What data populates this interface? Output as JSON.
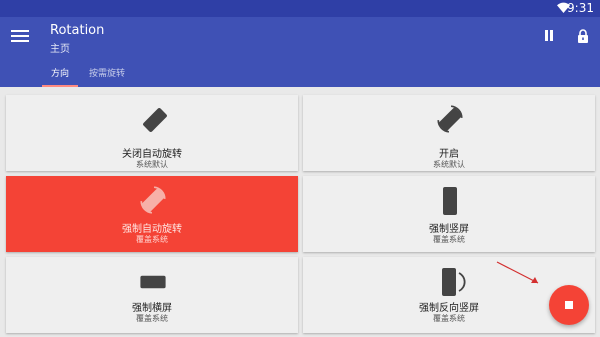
{
  "status": {
    "time": "9:31",
    "wifi_icon": "wifi-icon"
  },
  "appbar": {
    "title": "Rotation",
    "subtitle": "主页",
    "menu_icon": "menu-icon",
    "pause_icon": "pause-icon",
    "lock_icon": "lock-icon"
  },
  "tabs": [
    {
      "label": "方向",
      "active": true
    },
    {
      "label": "按需旋转",
      "active": false
    }
  ],
  "cards": [
    {
      "label": "关闭自动旋转",
      "sub": "系统默认",
      "icon": "rotation-off-icon",
      "active": false
    },
    {
      "label": "开启",
      "sub": "系统默认",
      "icon": "auto-rotate-icon",
      "active": false
    },
    {
      "label": "强制自动旋转",
      "sub": "覆盖系统",
      "icon": "forced-auto-rotate-icon",
      "active": true
    },
    {
      "label": "强制竖屏",
      "sub": "覆盖系统",
      "icon": "portrait-icon",
      "active": false
    },
    {
      "label": "强制横屏",
      "sub": "覆盖系统",
      "icon": "landscape-icon",
      "active": false
    },
    {
      "label": "强制反向竖屏",
      "sub": "覆盖系统",
      "icon": "reverse-portrait-icon",
      "active": false
    }
  ],
  "fab": {
    "icon": "stop-icon"
  },
  "colors": {
    "primary": "#3f51b5",
    "primary_dark": "#2f3fa6",
    "accent": "#f44336",
    "tab_indicator": "#ff8a80"
  }
}
